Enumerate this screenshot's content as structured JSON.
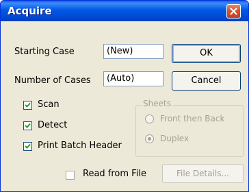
{
  "window": {
    "title": "Acquire"
  },
  "fields": {
    "starting_case": {
      "label": "Starting Case",
      "value": "(New)"
    },
    "number_of_cases": {
      "label": "Number of Cases",
      "value": "(Auto)"
    }
  },
  "buttons": {
    "ok": "OK",
    "cancel": "Cancel",
    "file_details": "File Details..."
  },
  "checkboxes": [
    {
      "label": "Scan",
      "checked": true
    },
    {
      "label": "Detect",
      "checked": true
    },
    {
      "label": "Print Batch Header",
      "checked": true
    }
  ],
  "sheets": {
    "label": "Sheets",
    "options": [
      {
        "label": "Front then Back",
        "selected": false
      },
      {
        "label": "Duplex",
        "selected": true
      }
    ]
  },
  "read_from_file": {
    "label": "Read from File",
    "checked": false
  },
  "colors": {
    "title_bar": "#0054e3",
    "close_button": "#d5502b",
    "dialog_bg": "#ece9d8"
  }
}
